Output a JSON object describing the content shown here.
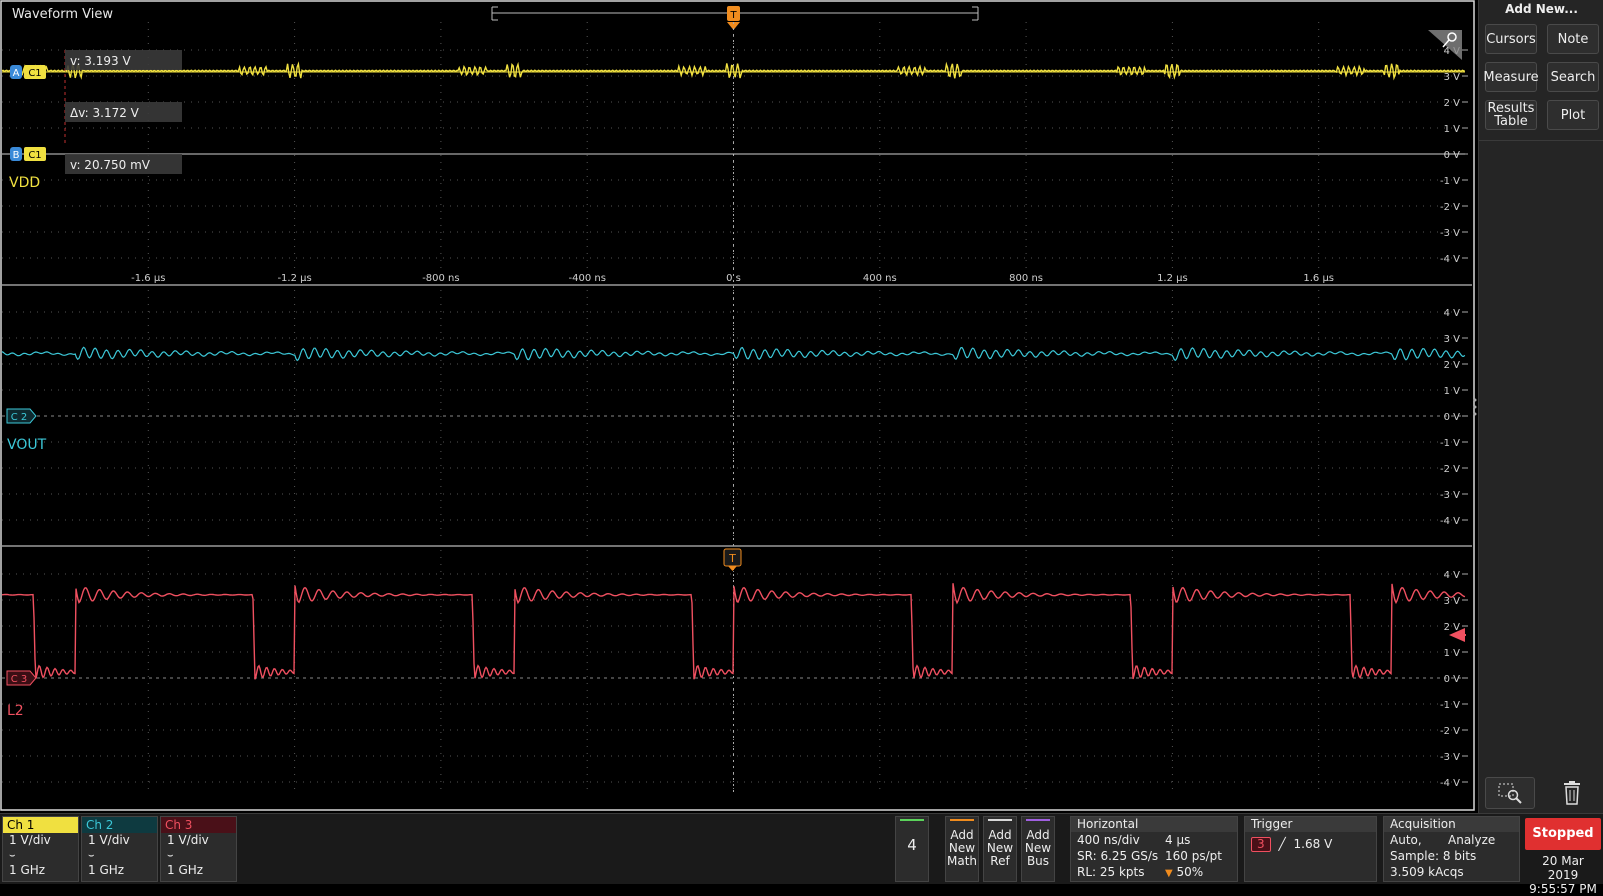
{
  "window": {
    "title": "Waveform View"
  },
  "colors": {
    "ch1": "#f0e040",
    "ch2": "#3cc8d8",
    "ch3": "#f05060",
    "trigger": "#f08c1e",
    "grid": "#555555"
  },
  "time_labels": [
    "-1.6 µs",
    "-1.2 µs",
    "-800 ns",
    "-400 ns",
    "0 s",
    "400 ns",
    "800 ns",
    "1.2 µs",
    "1.6 µs"
  ],
  "volt_labels": [
    "4 V",
    "3 V",
    "2 V",
    "1 V",
    "0 V",
    "-1 V",
    "-2 V",
    "-3 V",
    "-4 V"
  ],
  "cursor_readouts": {
    "a": "v: 3.193 V",
    "delta": "Δv: 3.172 V",
    "b": "v: 20.750 mV"
  },
  "cursor_tags": {
    "a": "A",
    "b": "B",
    "src": "C1"
  },
  "channels": [
    {
      "id": "C1",
      "name": "VDD",
      "tag": "C1"
    },
    {
      "id": "C2",
      "name": "VOUT",
      "tag": "C 2"
    },
    {
      "id": "C3",
      "name": "L2",
      "tag": "C 3"
    }
  ],
  "trigger_marker": "T",
  "side_panel": {
    "title": "Add New...",
    "buttons": {
      "cursors": "Cursors",
      "note": "Note",
      "measure": "Measure",
      "search": "Search",
      "results_1": "Results",
      "results_2": "Table",
      "plot": "Plot"
    },
    "icons": [
      "zoom-icon",
      "trash-icon"
    ]
  },
  "bottom_bar": {
    "channels": [
      {
        "label": "Ch 1",
        "scale": "1 V/div",
        "bw": "1 GHz"
      },
      {
        "label": "Ch 2",
        "scale": "1 V/div",
        "bw": "1 GHz"
      },
      {
        "label": "Ch 3",
        "scale": "1 V/div",
        "bw": "1 GHz"
      }
    ],
    "inactive_channel": "4",
    "add_math": [
      "Add",
      "New",
      "Math"
    ],
    "add_ref": [
      "Add",
      "New",
      "Ref"
    ],
    "add_bus": [
      "Add",
      "New",
      "Bus"
    ],
    "horizontal": {
      "title": "Horizontal",
      "scale": "400 ns/div",
      "record_time": "4 µs",
      "sample_rate": "SR: 6.25 GS/s",
      "resolution": "160 ps/pt",
      "record_length": "RL: 25 kpts",
      "position": "50%"
    },
    "trigger": {
      "title": "Trigger",
      "source": "3",
      "level": "1.68 V"
    },
    "acquisition": {
      "title": "Acquisition",
      "mode": "Auto,",
      "analyze": "Analyze",
      "sample": "Sample: 8 bits",
      "count": "3.509 kAcqs"
    },
    "run_state": "Stopped",
    "date": "20 Mar 2019",
    "time": "9:55:57 PM"
  }
}
